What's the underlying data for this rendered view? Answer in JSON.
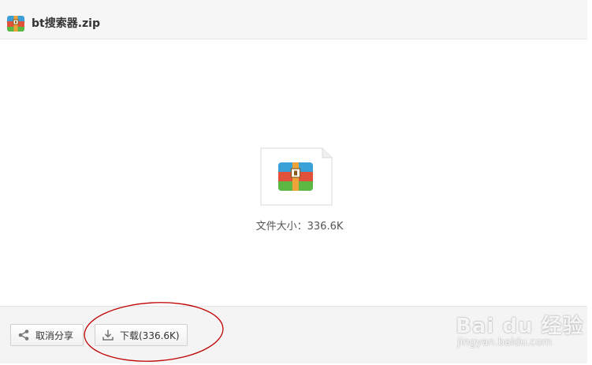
{
  "window": {
    "title": "bt搜索器.zip",
    "icon": "archive-icon"
  },
  "preview": {
    "file_icon": "zip-archive-icon",
    "size_label": "文件大小：336.6K"
  },
  "footer": {
    "cancel_share_label": "取消分享",
    "cancel_share_icon": "share-icon",
    "download_label": "下载(336.6K)",
    "download_icon": "download-icon"
  },
  "annotation": {
    "color": "#c00000"
  },
  "watermark": {
    "logo_text": "Bai du 经验",
    "url": "jingyan.baidu.com"
  },
  "colors": {
    "archive_blue": "#3aa0d8",
    "archive_red": "#e0533a",
    "archive_green": "#5cb843",
    "archive_strap": "#f0a23a"
  }
}
